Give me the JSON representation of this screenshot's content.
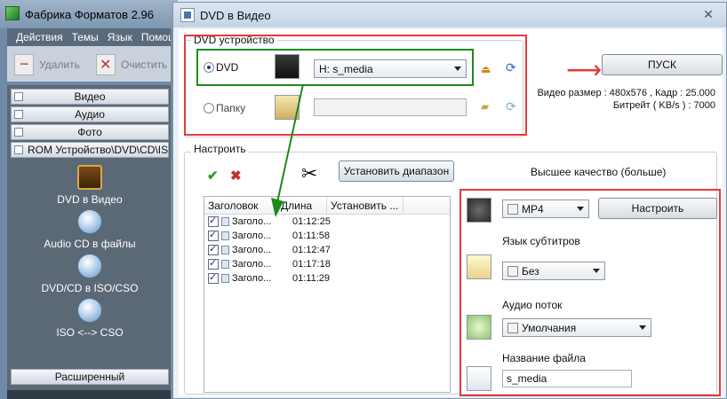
{
  "bg_app": {
    "title": "Фабрика Форматов 2.96",
    "menu": [
      "Действия",
      "Темы",
      "Язык",
      "Помощь"
    ],
    "toolbar": {
      "remove": "Удалить",
      "clear": "Очистить"
    },
    "categories": {
      "video": "Видео",
      "audio": "Аудио",
      "photo": "Фото",
      "rom": "ROM Устройство\\DVD\\CD\\ISO",
      "advanced": "Расширенный"
    },
    "tools": [
      {
        "label": "DVD в Видео"
      },
      {
        "label": "Audio CD в файлы"
      },
      {
        "label": "DVD/CD в ISO/CSO"
      },
      {
        "label": "ISO <--> CSO"
      }
    ]
  },
  "dialog": {
    "title": "DVD в Видео",
    "dvd_group": {
      "label": "DVD устройство",
      "dvd_radio": "DVD",
      "folder_radio": "Папку",
      "drive_value": "H:  s_media"
    },
    "start_button": "ПУСК",
    "video_size": "Видео размер : 480x576 , Кадр : 25.000",
    "bitrate": "Битрейт ( KB/s ) : 7000",
    "settings_group": {
      "label": "Настроить"
    },
    "set_range_button": "Установить диапазон",
    "quality_label": "Высшее качество (больше)",
    "table": {
      "columns": [
        "Заголовок",
        "Длина",
        "Установить ..."
      ],
      "rows": [
        {
          "title": "Заголо...",
          "length": "01:12:25"
        },
        {
          "title": "Заголо...",
          "length": "01:11:58"
        },
        {
          "title": "Заголо...",
          "length": "01:12:47"
        },
        {
          "title": "Заголо...",
          "length": "01:17:18"
        },
        {
          "title": "Заголо...",
          "length": "01:11:29"
        }
      ]
    },
    "format_value": "MP4",
    "configure_button": "Настроить",
    "subtitles_label": "Язык субтитров",
    "subtitles_value": "Без",
    "audio_label": "Аудио поток",
    "audio_value": "Умолчания",
    "filename_label": "Название файла",
    "filename_value": "s_media"
  },
  "colors": {
    "highlight_red": "#e63a3a",
    "highlight_green": "#1e8a1e"
  }
}
